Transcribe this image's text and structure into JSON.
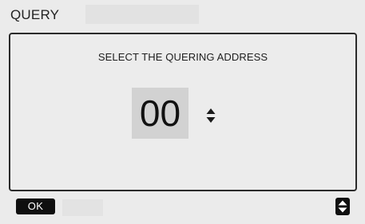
{
  "header": {
    "title": "QUERY"
  },
  "panel": {
    "prompt": "SELECT THE QUERING ADDRESS",
    "address_value": "00",
    "adjust_icon": "up-down-arrows-icon"
  },
  "footer": {
    "ok_label": "OK",
    "scroll_icon": "up-down-scroll-icon"
  },
  "colors": {
    "background": "#ebebeb",
    "panel_border": "#2b2b2b",
    "value_highlight": "#d2d2d2",
    "button_dark": "#0f0f0f"
  }
}
